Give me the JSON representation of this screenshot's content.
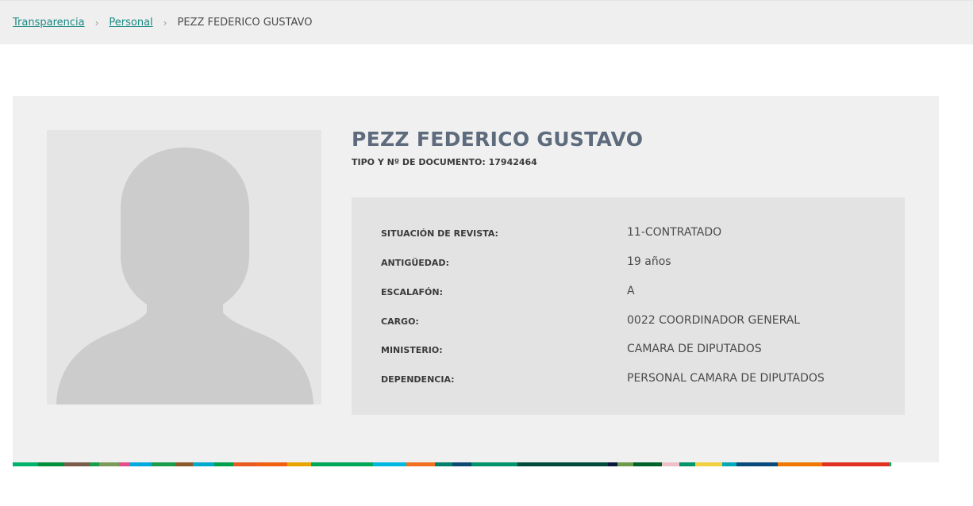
{
  "breadcrumb": {
    "items": [
      "Transparencia",
      "Personal"
    ],
    "current": "PEZZ FEDERICO GUSTAVO",
    "separator": "›"
  },
  "profile": {
    "name": "PEZZ FEDERICO GUSTAVO",
    "document_label": "TIPO Y Nº DE DOCUMENTO:",
    "document_number": "17942464"
  },
  "details": [
    {
      "label": "SITUACIÓN DE REVISTA:",
      "value": "11-CONTRATADO"
    },
    {
      "label": "ANTIGÜEDAD:",
      "value": "19 años"
    },
    {
      "label": "ESCALAFÓN:",
      "value": "A"
    },
    {
      "label": "CARGO:",
      "value": "0022 COORDINADOR GENERAL"
    },
    {
      "label": "MINISTERIO:",
      "value": "CAMARA DE DIPUTADOS"
    },
    {
      "label": "DEPENDENCIA:",
      "value": "PERSONAL CAMARA DE DIPUTADOS"
    }
  ],
  "colors": {
    "link": "#1a8a84",
    "name": "#5d6b7d",
    "stripe": [
      "#00b36b",
      "#008f3a",
      "#7a5c4a",
      "#1a9c4a",
      "#7a9a5a",
      "#e64b8a",
      "#00aadd",
      "#1a9c4a",
      "#8a5a2a",
      "#00aacc",
      "#00a04a",
      "#e85a20",
      "#f06010",
      "#e8a400",
      "#00a85a",
      "#00b8e0",
      "#f07020",
      "#00806a",
      "#0a4a70",
      "#00946a",
      "#004a3a",
      "#0a1a3a",
      "#6a9a4a",
      "#00602a",
      "#f0c0c8",
      "#00946a",
      "#f0d040",
      "#00a8b8",
      "#0a4a7a",
      "#f07800",
      "#e03020"
    ]
  }
}
